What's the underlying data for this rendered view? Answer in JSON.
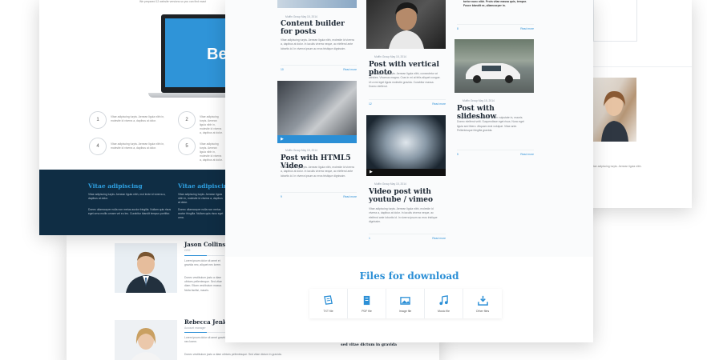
{
  "left_page": {
    "intro_text": "We prepared 12 website versions so you can find exact",
    "laptop_screen_text": "Be",
    "features": [
      {
        "num": "1",
        "text": "Vitae adipiscing turpis. Aenean ligula nibh in, molestie id viverra a, dapibus at dolor."
      },
      {
        "num": "2",
        "text": "Vitae adipiscing turpis. Aenean ligula nibh in, molestie id viverra a, dapibus at dolor."
      },
      {
        "num": "4",
        "text": "Vitae adipiscing turpis. Aenean ligula nibh in, molestie id viverra a, dapibus at dolor."
      },
      {
        "num": "5",
        "text": "Vitae adipiscing turpis. Aenean ligula nibh in, molestie id viverra a, dapibus at dolor."
      }
    ],
    "band": [
      {
        "title": "Vitae adipiscing",
        "text1": "Vitae adipiscing turpis. Aenean ligula nibh, mol lexte id viverra a, dapibus at dolor.",
        "text2": "Donec ullamcorper nulla non metus auctor fringilla. Nullam quis risus eget urna mollis ornare vel eu leo. Curabitur blandit tempus porttitor."
      },
      {
        "title": "Vitae adipiscing",
        "text1": "Vitae adipiscing turpis. Aenean ligula nibh in, molestie id viverra a, dapibus at dolor.",
        "text2": "Donec ullamcorper nulla non metus auctor fringilla. Nullam quis risus eget urna."
      }
    ]
  },
  "blog": {
    "posts": [
      {
        "title": "Content builder for posts",
        "meta": "Muffin Group  May 15, 2014",
        "excerpt": "Vitae adipiscing turpis. Aenean ligula nibh, molestie id viverra a, dapibus at dolor. In iaculis viverra neque, ac eleifend ante lobortis id. In viverra ipsum ac eros tristique dignissim.",
        "comments": "10",
        "likes": "0",
        "read": "Read more"
      },
      {
        "title": "Post with HTML5 Video",
        "meta": "Muffin Group  May 15, 2014",
        "excerpt": "Vitae adipiscing turpis. Aenean ligula nibh, molestie id viverra a, dapibus at dolor. In iaculis viverra neque, ac eleifend ante lobortis id. In viverra ipsum ac eros tristique dignissim.",
        "comments": "9",
        "likes": "0",
        "read": "Read more"
      },
      {
        "title": "Post with vertical photo",
        "meta": "Muffin Group  May 15, 2014",
        "excerpt": "Vitae adipiscing turpis. Aenean ligula nibh, consectetur at ultricies. Vivamus magna. Cras in mi at felis aliquet congue. Ut a est eget ligula molestie gravida. Curabitur massa. Donec eleifend.",
        "comments": "12",
        "likes": "0",
        "read": "Read more"
      },
      {
        "title": "Video post with youtube / vimeo",
        "meta": "Muffin Group  May 15, 2014",
        "excerpt": "Vitae adipiscing turpis. Aenean ligula nibh, molestie id viverra a, dapibus at dolor. In iaculis viverra neque, ac eleifend ante lobortis id. In viverra ipsum ac eros tristique dignissim.",
        "comments": "1",
        "likes": "0",
        "read": "Read more"
      },
      {
        "title": "Post with slideshow",
        "meta": "Muffin Group  May 15, 2014",
        "excerpt": "Integer gravida eros id arcu. Proin vulputate in, mauris. Donec eleifend velit. Suspendisse eget risus. Nunc eget ligula sed libero. Aliquam erat volutpat. Vitae ante. Pellentesque fringilla gravida.",
        "comments": "5",
        "likes": "0",
        "read": "Read more"
      }
    ],
    "top_right_text": "tortor nunc nibh. Proin vitae massa quis, tempor. Fusce blandit ex, ullamcorper in.",
    "top_right_comments": "8",
    "top_right_read": "Read more",
    "files_title": "Files for download",
    "files": [
      {
        "label": "TXT file",
        "icon": "txt-file-icon"
      },
      {
        "label": "PDF file",
        "icon": "pdf-file-icon"
      },
      {
        "label": "Image file",
        "icon": "image-file-icon"
      },
      {
        "label": "Music file",
        "icon": "music-file-icon"
      },
      {
        "label": "Other files",
        "icon": "download-icon"
      }
    ]
  },
  "team": [
    {
      "name": "Jason Collins",
      "role": "CEO",
      "text1": "Lorem ipsum dolor sit amet et gravida nec, aliquet nec lorem.",
      "text2": "Donec vestibulum justo a diam ultrices pellentesque. Sed vitae diam. Etiam vestibulum massa. Nulla facilisi, mauris."
    },
    {
      "name": "Rebecca Jenkins",
      "role": "Account manager",
      "text1": "Lorem ipsum dolor sit amet gravida nec, aliquet nec lorem.",
      "text2": "Donec vestibulum justo a diam ultrices pellentesque. Sed vitae dictum in gravida."
    }
  ],
  "right_page": {
    "side_text": "Vitae adipiscing turpis. Aenean ligula nibh."
  },
  "bottom_snippet": "sed vitae dictum in gravida"
}
